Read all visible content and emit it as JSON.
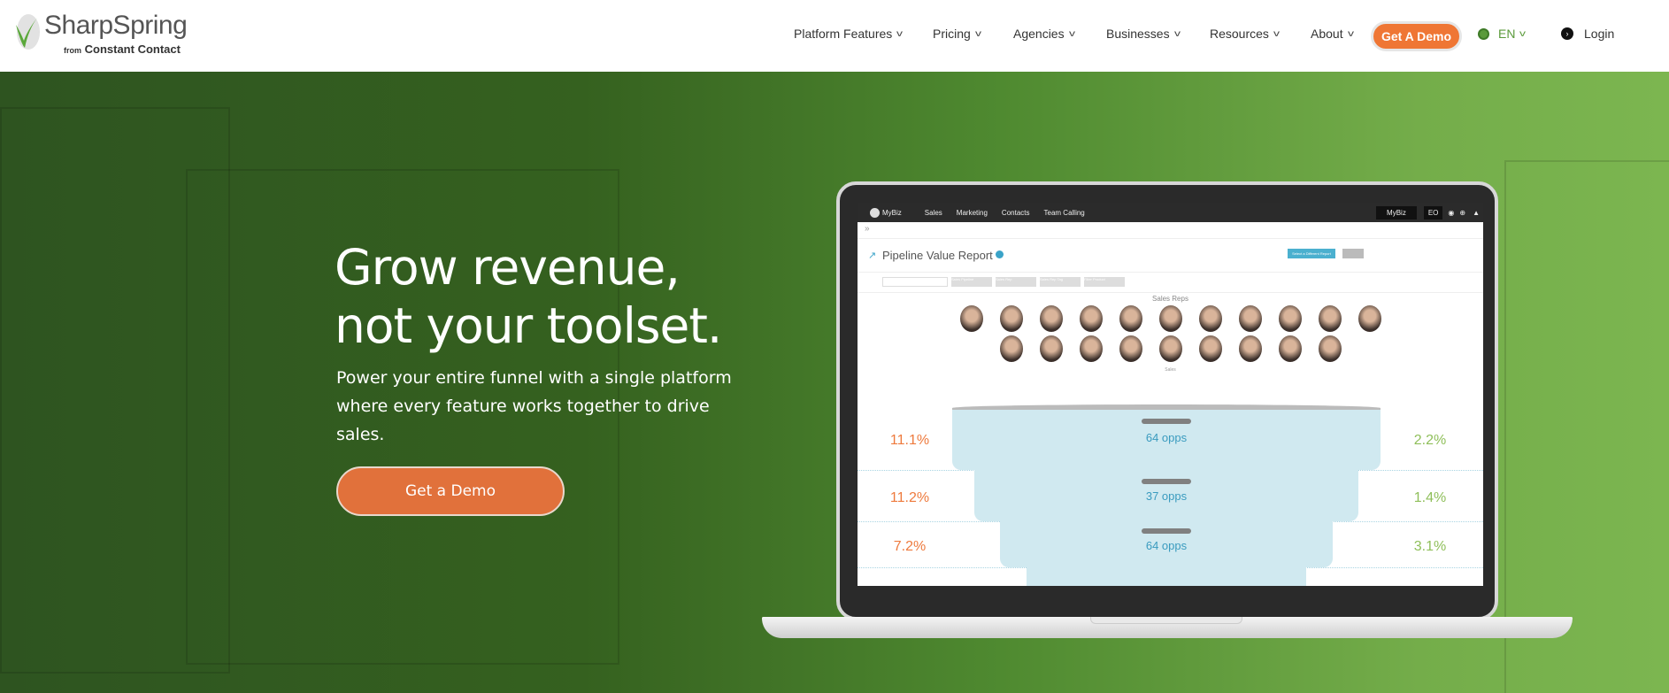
{
  "header": {
    "logo": {
      "name": "SharpSpring",
      "from": "from",
      "company": "Constant Contact"
    },
    "nav": [
      {
        "label": "Platform Features",
        "icon": "chevron-down-icon"
      },
      {
        "label": "Pricing",
        "icon": "chevron-down-icon"
      },
      {
        "label": "Agencies",
        "icon": "chevron-down-icon"
      },
      {
        "label": "Businesses",
        "icon": "chevron-down-icon"
      },
      {
        "label": "Resources",
        "icon": "chevron-down-icon"
      },
      {
        "label": "About",
        "icon": "chevron-down-icon"
      }
    ],
    "demo_button": "Get A Demo",
    "language": "EN",
    "login": "Login",
    "accent": "#ef7634"
  },
  "hero": {
    "title_line1": "Grow revenue,",
    "title_line2": "not your toolset.",
    "subtitle": "Power your entire funnel with a single platform where every feature works together to drive sales.",
    "cta": "Get a Demo"
  },
  "app_preview": {
    "brand": "MyBiz",
    "menu": [
      "Sales",
      "Marketing",
      "Contacts",
      "Team Calling"
    ],
    "account": "MyBiz",
    "user_initials": "EO",
    "report_title": "Pipeline Value Report",
    "select_report_button": "Select a Different Report",
    "filters": [
      "Sales Pipeline",
      "Sales Rep",
      "Sales Rep Tag",
      "Filter Product"
    ],
    "sales_reps_label": "Sales Reps",
    "sales_label": "Sales",
    "funnel": [
      {
        "left": "11.1%",
        "opps": "64 opps",
        "right": "2.2%"
      },
      {
        "left": "11.2%",
        "opps": "37 opps",
        "right": "1.4%"
      },
      {
        "left": "7.2%",
        "opps": "64 opps",
        "right": "3.1%"
      }
    ]
  }
}
